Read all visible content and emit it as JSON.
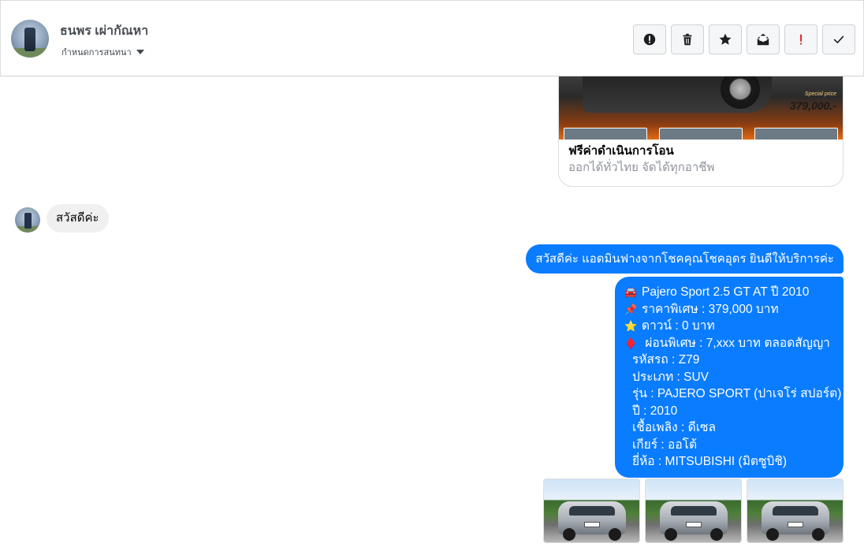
{
  "header": {
    "contact_name": "ธนพร เผ่ากัณหา",
    "conversation_settings": "กำหนดการสนทนา",
    "actions": [
      {
        "name": "report-button",
        "icon": "exclamation-circle-icon"
      },
      {
        "name": "delete-button",
        "icon": "trash-icon"
      },
      {
        "name": "star-button",
        "icon": "star-icon"
      },
      {
        "name": "mark-unread-button",
        "icon": "envelope-open-icon"
      },
      {
        "name": "spam-button",
        "icon": "red-exclamation-icon"
      },
      {
        "name": "done-button",
        "icon": "check-icon"
      }
    ]
  },
  "ad_card": {
    "price": "379,000.-",
    "special_label": "Special price",
    "title": "ฟรีค่าดำเนินการโอน",
    "subtitle": "ออกได้ทั่วไทย จัดได้ทุกอาชีพ"
  },
  "messages": {
    "incoming_greeting": "สวัสดีค่ะ",
    "outgoing_greeting": "สวัสดีค่ะ แอดมินฟางจากโชคคุณโชคอุดร ยินดีให้บริการค่ะ",
    "details": [
      {
        "icon": "🚘",
        "text": "Pajero Sport 2.5 GT AT ปี 2010"
      },
      {
        "icon": "📌",
        "text": "ราคาพิเศษ : 379,000 บาท"
      },
      {
        "icon": "⭐",
        "text": "ดาวน์ : 0 บาท"
      },
      {
        "icon": "♦️",
        "text": " ผ่อนพิเศษ : 7,xxx บาท ตลอดสัญญา"
      },
      {
        "icon": "",
        "text": "รหัสรถ : Z79"
      },
      {
        "icon": "",
        "text": "ประเภท : SUV"
      },
      {
        "icon": "",
        "text": "รุ่น : PAJERO SPORT (ปาเจโร่ สปอร์ต)"
      },
      {
        "icon": "",
        "text": "ปี : 2010"
      },
      {
        "icon": "",
        "text": "เชื้อเพลิง : ดีเซล"
      },
      {
        "icon": "",
        "text": "เกียร์ : ออโต้"
      },
      {
        "icon": "",
        "text": "ยี่ห้อ : MITSUBISHI (มิตซูบิชิ)"
      }
    ]
  },
  "colors": {
    "outgoing_bubble": "#0a7cff",
    "incoming_bubble": "#f1f0f0",
    "spam_icon": "#e02424"
  }
}
